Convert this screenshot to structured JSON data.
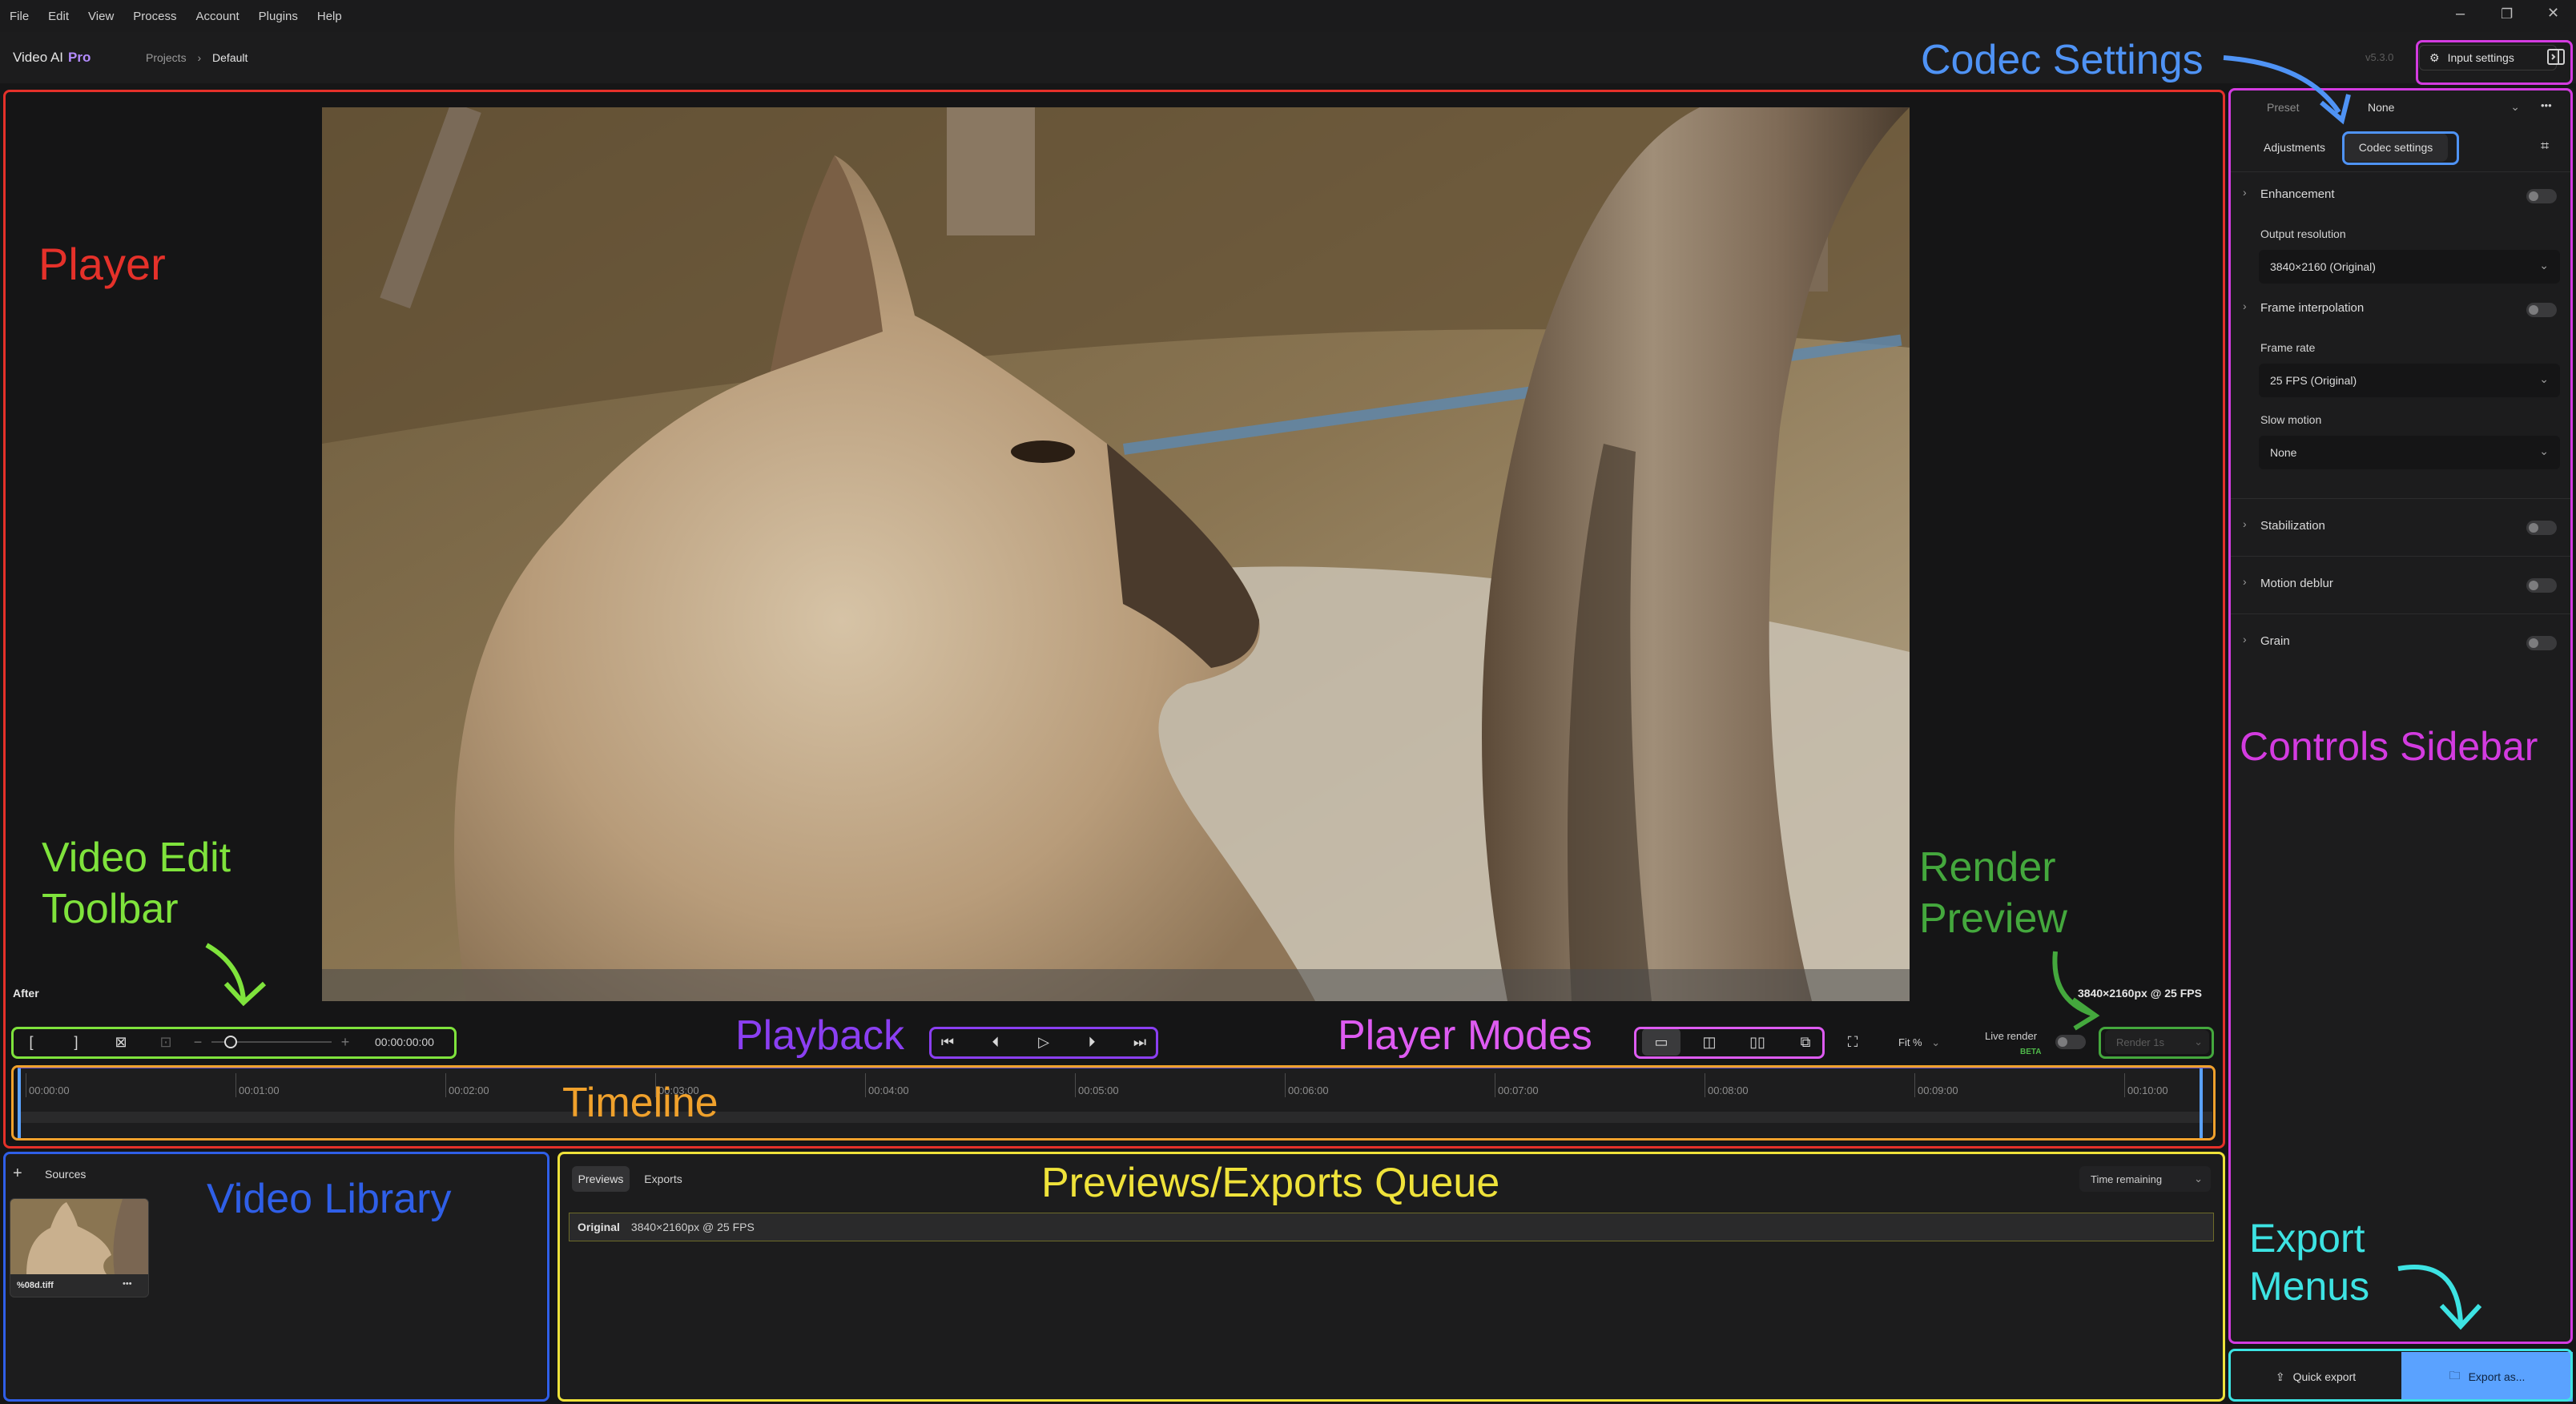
{
  "menu": [
    "File",
    "Edit",
    "View",
    "Process",
    "Account",
    "Plugins",
    "Help"
  ],
  "window_controls": {
    "minimize": "–",
    "restore": "❐",
    "close": "✕"
  },
  "app": {
    "name": "Video AI",
    "edition": "Pro",
    "version": "v5.3.0"
  },
  "breadcrumb": {
    "parent": "Projects",
    "current": "Default"
  },
  "header": {
    "input_settings": "Input settings"
  },
  "player": {
    "view_label": "After",
    "resolution": "3840×2160px @ 25 FPS",
    "timecode": "00:00:00:00",
    "fit": "Fit %",
    "live_render": "Live render",
    "beta": "BETA",
    "render_button": "Render 1s"
  },
  "timeline": {
    "ticks": [
      "00:00:00",
      "00:01:00",
      "00:02:00",
      "00:03:00",
      "00:04:00",
      "00:05:00",
      "00:06:00",
      "00:07:00",
      "00:08:00",
      "00:09:00",
      "00:10:00"
    ]
  },
  "library": {
    "title": "Sources",
    "add": "+",
    "file_name": "%08d.tiff",
    "more": "•••"
  },
  "queue": {
    "tabs": [
      "Previews",
      "Exports"
    ],
    "sort": "Time remaining",
    "row": {
      "label": "Original",
      "info": "3840×2160px @ 25 FPS"
    }
  },
  "sidebar": {
    "preset_label": "Preset",
    "preset_value": "None",
    "more": "•••",
    "tabs": [
      "Adjustments",
      "Codec settings"
    ],
    "enhancement": "Enhancement",
    "output_resolution_label": "Output resolution",
    "output_resolution_value": "3840×2160 (Original)",
    "frame_interpolation": "Frame interpolation",
    "frame_rate_label": "Frame rate",
    "frame_rate_value": "25 FPS (Original)",
    "slow_motion_label": "Slow motion",
    "slow_motion_value": "None",
    "stabilization": "Stabilization",
    "motion_deblur": "Motion deblur",
    "grain": "Grain"
  },
  "export": {
    "quick": "Quick export",
    "as": "Export as..."
  },
  "annotations": {
    "player": "Player",
    "codec_settings": "Codec Settings",
    "controls_sidebar": "Controls Sidebar",
    "video_edit_toolbar_1": "Video Edit",
    "video_edit_toolbar_2": "Toolbar",
    "playback": "Playback",
    "player_modes": "Player Modes",
    "render_preview_1": "Render",
    "render_preview_2": "Preview",
    "timeline": "Timeline",
    "video_library": "Video Library",
    "queue": "Previews/Exports Queue",
    "export_menus_1": "Export",
    "export_menus_2": "Menus"
  },
  "colors": {
    "player": "#e5312a",
    "codec": "#4f93f5",
    "sidebar": "#d33be0",
    "toolbar": "#7fe33c",
    "playback": "#8b3ff2",
    "modes": "#de5bf2",
    "render": "#44a83d",
    "timeline": "#f0a12c",
    "library": "#2f5fe8",
    "queue": "#efe23a",
    "export": "#3de3e3",
    "accent": "#5aa2ff"
  }
}
